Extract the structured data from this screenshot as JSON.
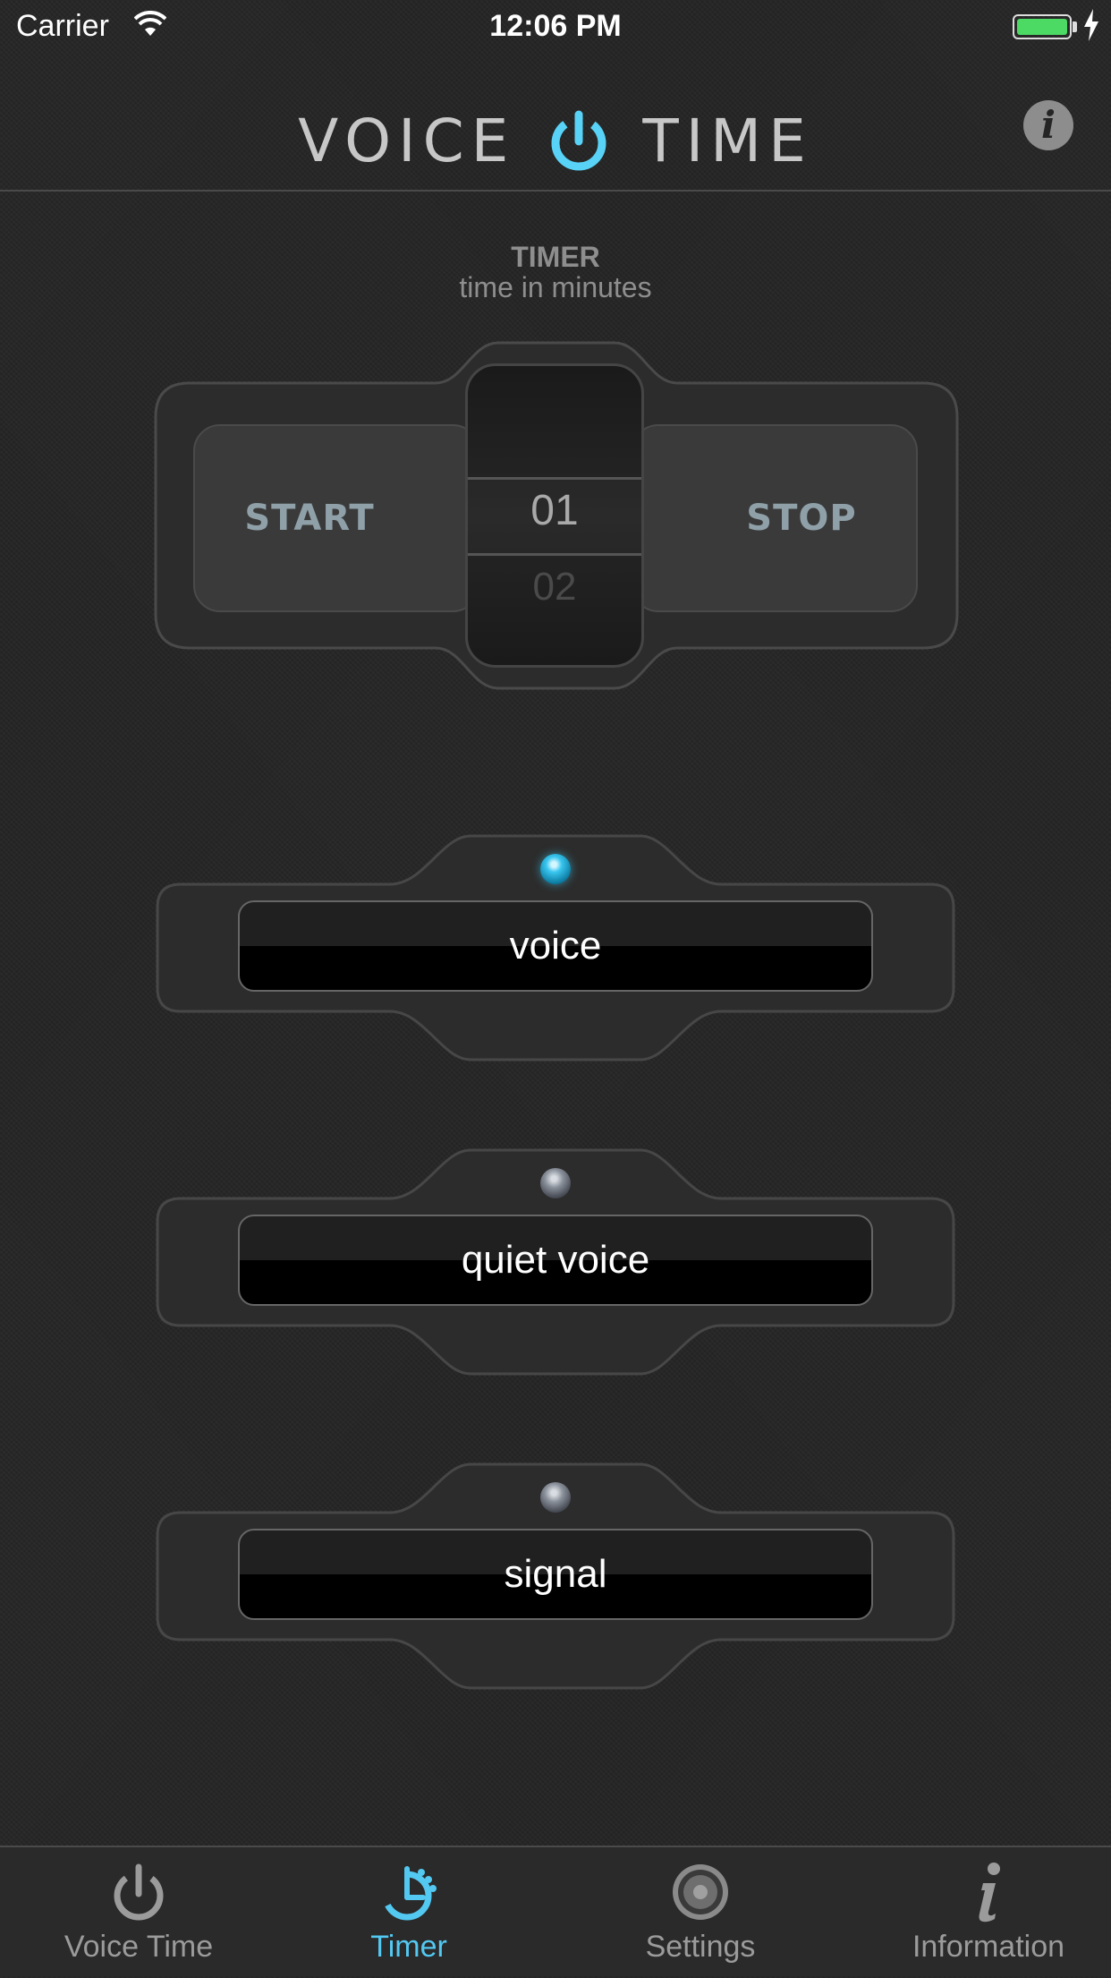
{
  "status_bar": {
    "carrier": "Carrier",
    "time": "12:06 PM"
  },
  "header": {
    "logo_left": "VOICE",
    "logo_right": "TIME",
    "info_label": "i"
  },
  "timer": {
    "title": "TIMER",
    "subtitle": "time in minutes",
    "start_label": "START",
    "stop_label": "STOP",
    "picker_selected": "01",
    "picker_next": "02"
  },
  "modes": [
    {
      "label": "voice",
      "active": true
    },
    {
      "label": "quiet voice",
      "active": false
    },
    {
      "label": "signal",
      "active": false
    }
  ],
  "tabs": [
    {
      "label": "Voice Time",
      "icon": "power-icon",
      "active": false
    },
    {
      "label": "Timer",
      "icon": "timer-icon",
      "active": true
    },
    {
      "label": "Settings",
      "icon": "speaker-icon",
      "active": false
    },
    {
      "label": "Information",
      "icon": "info-icon",
      "active": false
    }
  ],
  "colors": {
    "accent": "#53c8f0",
    "background": "#252525",
    "battery": "#4cd964"
  }
}
